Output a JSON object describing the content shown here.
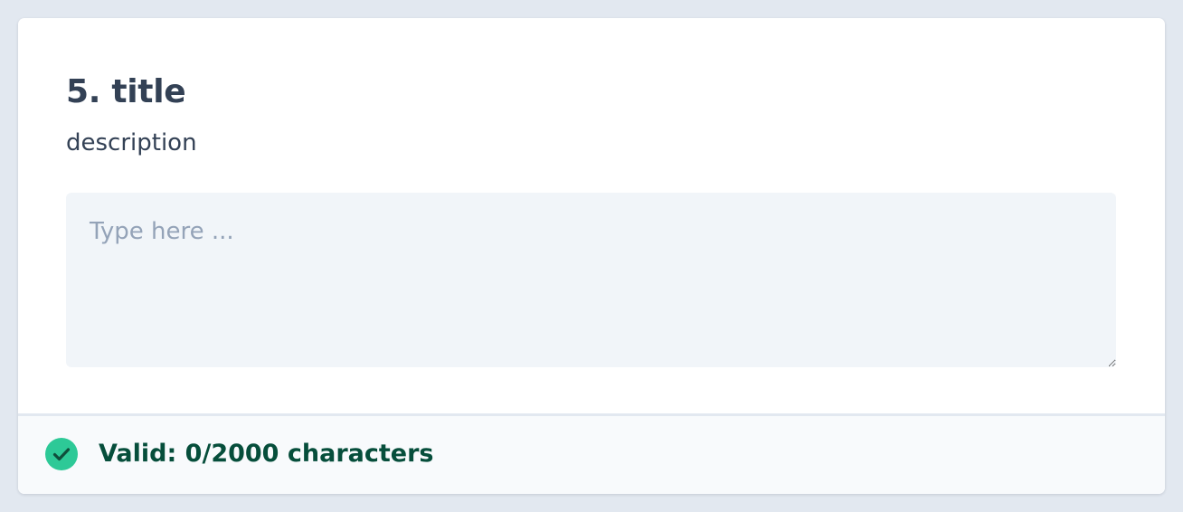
{
  "question": {
    "title": "5. title",
    "description": "description"
  },
  "answer": {
    "value": "",
    "placeholder": "Type here ..."
  },
  "status": {
    "icon": "check-circle-icon",
    "text": "Valid: 0/2000 characters",
    "color": "#2dc997"
  }
}
